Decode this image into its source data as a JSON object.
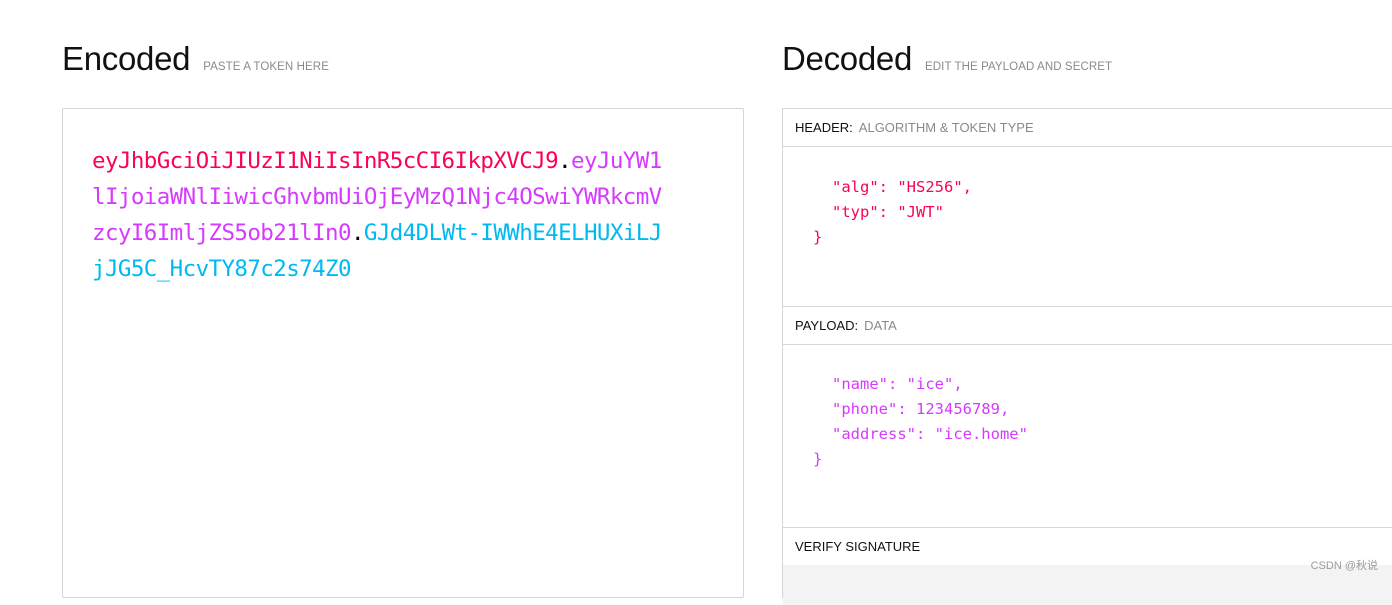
{
  "encoded": {
    "title": "Encoded",
    "subtitle": "PASTE A TOKEN HERE",
    "token": {
      "header_part": "eyJhbGciOiJIUzI1NiIsInR5cCI6IkpXVCJ9",
      "dot1": ".",
      "payload_part": "eyJuYW1lIjoiaWNlIiwicGhvbmUiOjEyMzQ1Njc4OSwiYWRkcmVzcyI6ImljZS5ob21lIn0",
      "dot2": ".",
      "signature_part": "GJd4DLWt-IWWhE4ELHUXiLJjJG5C_HcvTY87c2s74Z0"
    }
  },
  "decoded": {
    "title": "Decoded",
    "subtitle": "EDIT THE PAYLOAD AND SECRET",
    "header_section": {
      "label": "HEADER:",
      "sublabel": "ALGORITHM & TOKEN TYPE",
      "lines": [
        "\"alg\": \"HS256\",",
        "\"typ\": \"JWT\"",
        "}"
      ]
    },
    "payload_section": {
      "label": "PAYLOAD:",
      "sublabel": "DATA",
      "lines": [
        "\"name\": \"ice\",",
        "\"phone\": 123456789,",
        "\"address\": \"ice.home\"",
        "}"
      ]
    },
    "verify_section": {
      "label": "VERIFY SIGNATURE"
    }
  },
  "watermark": "CSDN @秋说",
  "colors": {
    "header": "#fb015b",
    "payload": "#d63aff",
    "signature": "#00b9f1"
  }
}
